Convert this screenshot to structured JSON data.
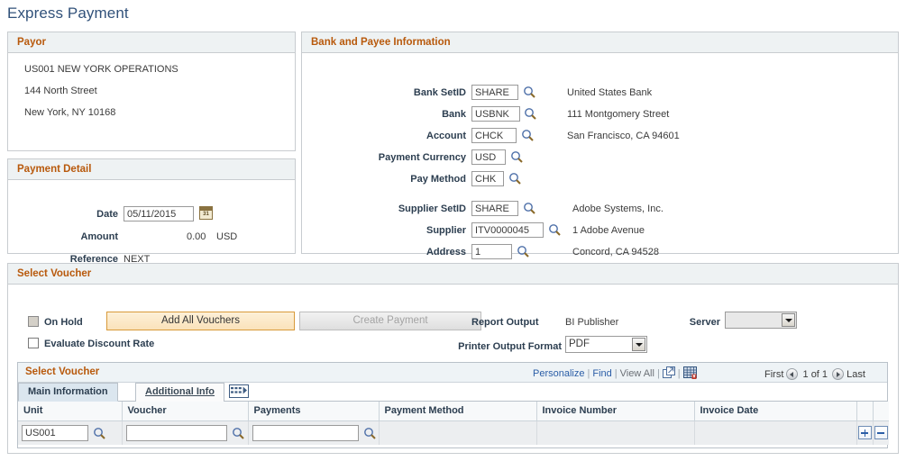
{
  "page": {
    "title": "Express Payment"
  },
  "payor": {
    "header": "Payor",
    "lines": [
      "US001 NEW YORK OPERATIONS",
      "144 North Street",
      "New York, NY  10168"
    ]
  },
  "payment_detail": {
    "header": "Payment Detail",
    "date_label": "Date",
    "date_value": "05/11/2015",
    "calendar_icon": "calendar-icon",
    "amount_label": "Amount",
    "amount_value": "0.00",
    "amount_currency": "USD",
    "reference_label": "Reference",
    "reference_value": "NEXT"
  },
  "bank_payee": {
    "header": "Bank and Payee Information",
    "fields": [
      {
        "label": "Bank SetID",
        "value": "SHARE"
      },
      {
        "label": "Bank",
        "value": "USBNK"
      },
      {
        "label": "Account",
        "value": "CHCK"
      },
      {
        "label": "Payment Currency",
        "value": "USD"
      },
      {
        "label": "Pay Method",
        "value": "CHK"
      }
    ],
    "bank_address": [
      "United States Bank",
      "111 Montgomery Street",
      "San Francisco, CA  94601"
    ],
    "supplier_fields": [
      {
        "label": "Supplier SetID",
        "value": "SHARE"
      },
      {
        "label": "Supplier",
        "value": "ITV0000045"
      },
      {
        "label": "Address",
        "value": "1"
      }
    ],
    "supplier_address": [
      "Adobe Systems, Inc.",
      "1 Adobe Avenue",
      "Concord, CA  94528"
    ],
    "prompt_icon": "magnifier-icon"
  },
  "select_voucher_section": {
    "header": "Select Voucher",
    "on_hold_label": "On Hold",
    "on_hold_checked": false,
    "on_hold_disabled": true,
    "evaluate_discount_label": "Evaluate Discount Rate",
    "evaluate_discount_checked": false,
    "add_all_vouchers_label": "Add All Vouchers",
    "create_payment_label": "Create Payment",
    "create_payment_disabled": true,
    "report_output_label": "Report Output",
    "report_output_value": "BI Publisher",
    "printer_output_format_label": "Printer Output Format",
    "printer_output_format_value": "PDF",
    "server_label": "Server",
    "server_value": ""
  },
  "grid": {
    "title": "Select Voucher",
    "links": {
      "personalize": "Personalize",
      "find": "Find",
      "view_all": "View All",
      "separator": "|",
      "new_window_icon": "new-window-icon",
      "download_excel_icon": "download-to-excel-icon"
    },
    "nav": {
      "first": "First",
      "counter": "1 of 1",
      "last": "Last",
      "prev_icon": "previous-arrow-icon",
      "next_icon": "next-arrow-icon"
    },
    "tabs": [
      {
        "label": "Main Information",
        "active": true
      },
      {
        "label": "Additional Info",
        "active": false
      }
    ],
    "tab_expand_icon": "show-all-columns-icon",
    "columns": [
      "Unit",
      "Voucher",
      "Payments",
      "Payment Method",
      "Invoice Number",
      "Invoice Date",
      "",
      ""
    ],
    "rows": [
      {
        "unit": "US001",
        "voucher": "",
        "payments": "",
        "payment_method": "",
        "invoice_number": "",
        "invoice_date": "",
        "add_row_icon": "add-row-icon",
        "delete_row_icon": "delete-row-icon"
      }
    ]
  }
}
